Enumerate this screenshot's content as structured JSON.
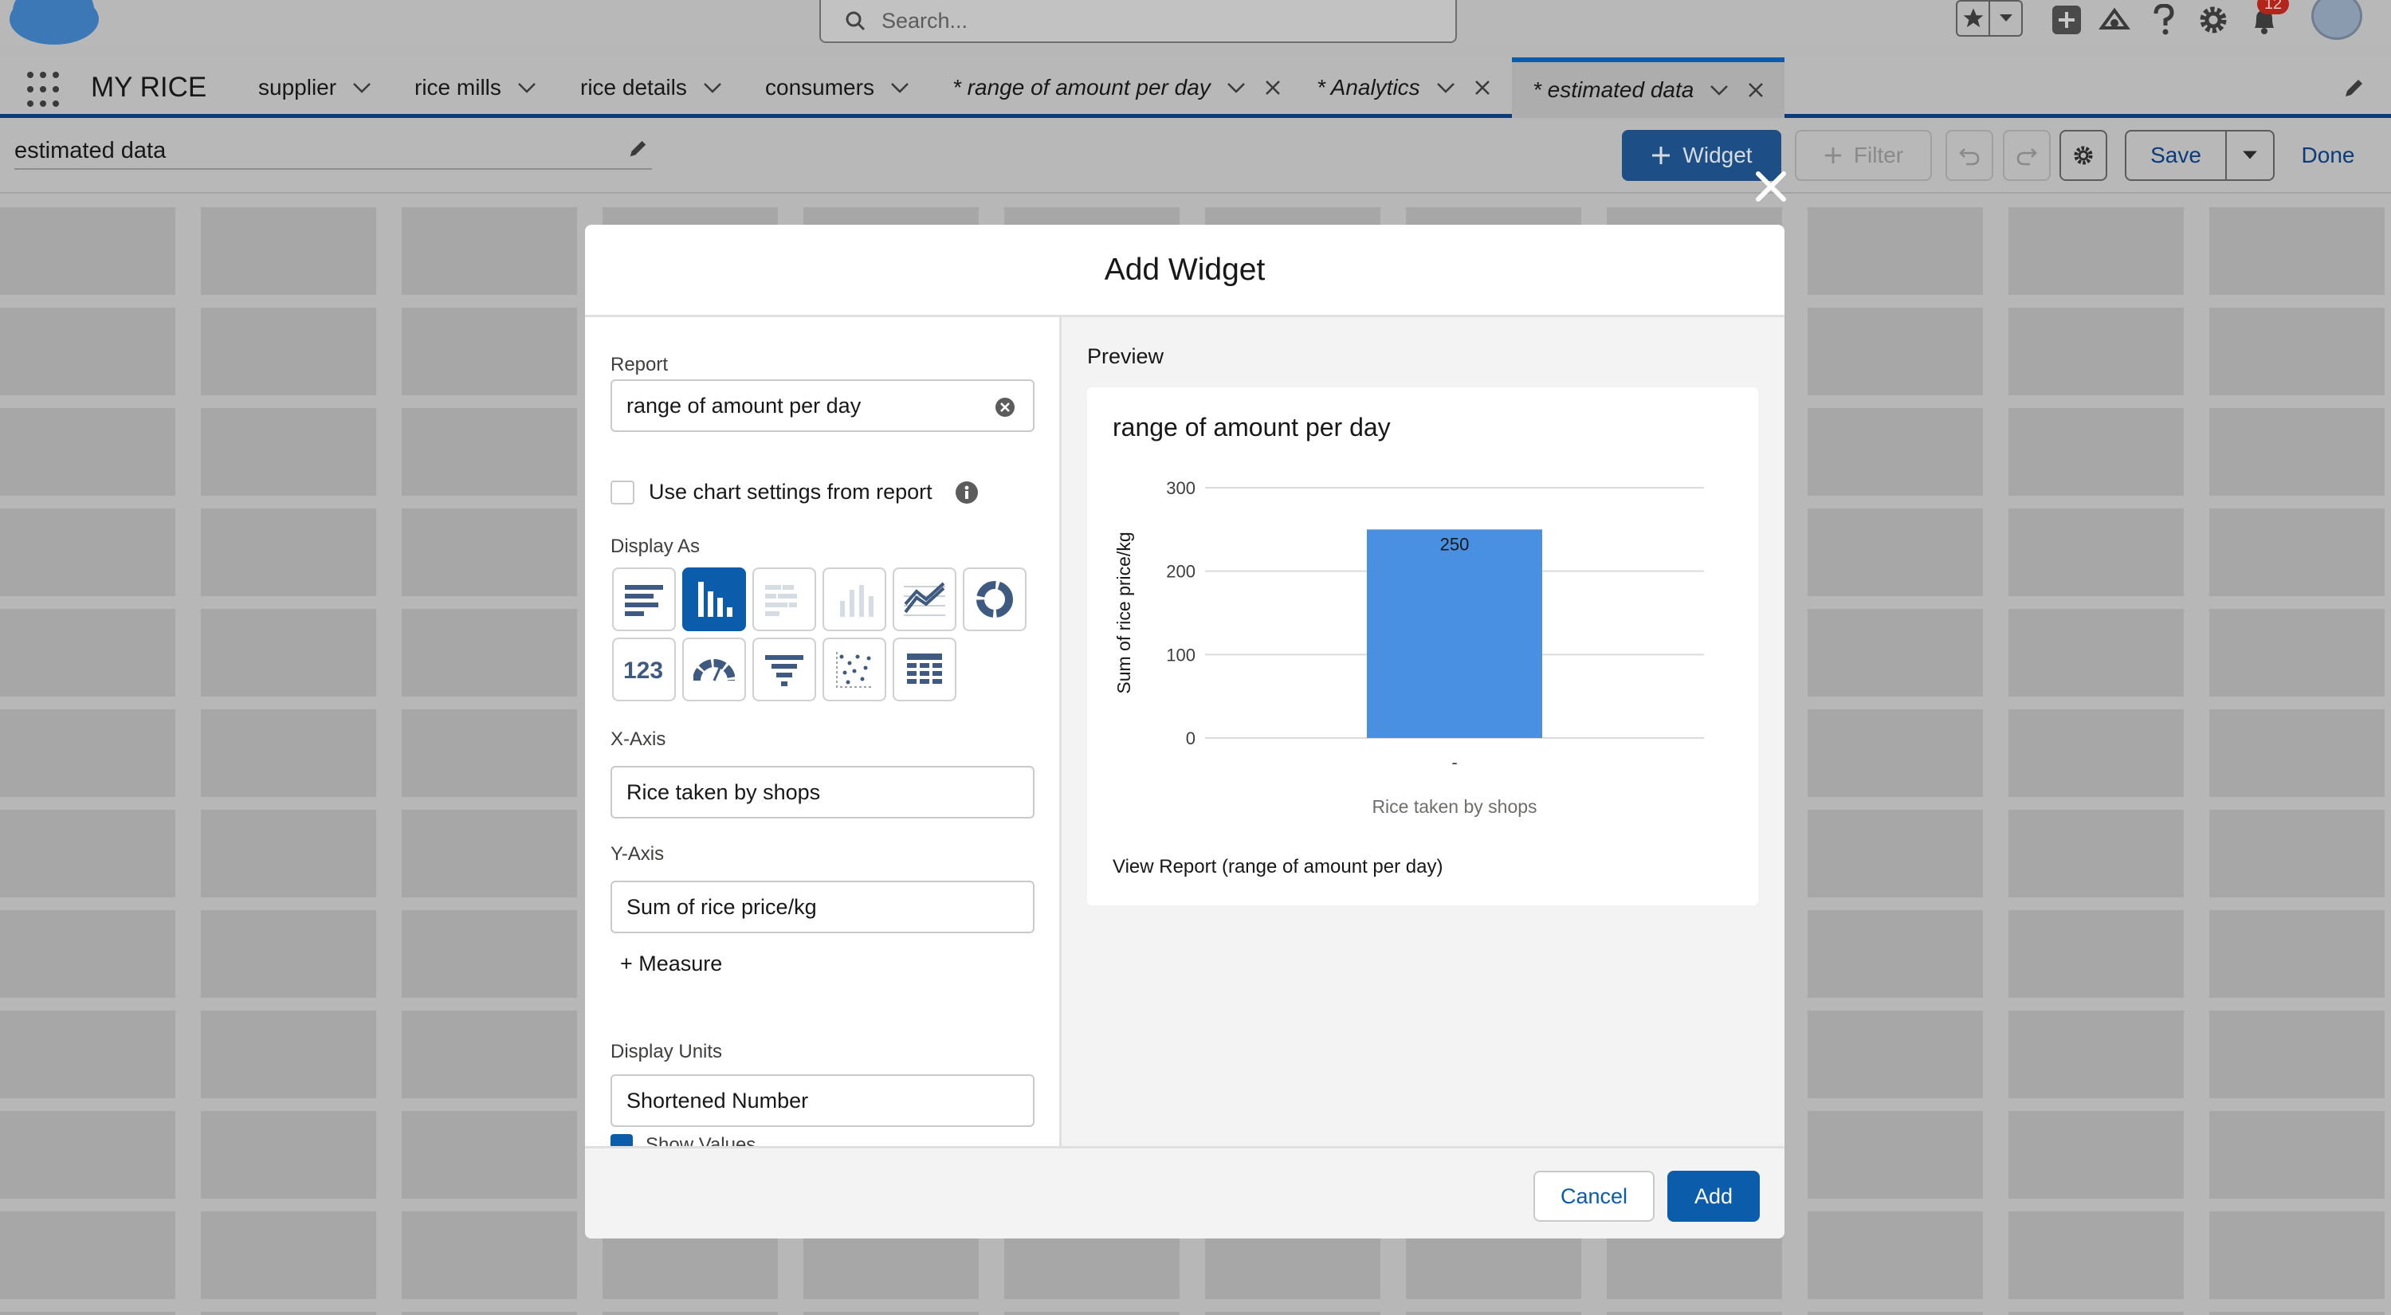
{
  "header": {
    "search_placeholder": "Search...",
    "notification_count": "12"
  },
  "nav": {
    "app_name": "MY RICE",
    "tabs": [
      {
        "label": "supplier",
        "closable": false,
        "italic": false
      },
      {
        "label": "rice mills",
        "closable": false,
        "italic": false
      },
      {
        "label": "rice details",
        "closable": false,
        "italic": false
      },
      {
        "label": "consumers",
        "closable": false,
        "italic": false
      },
      {
        "label": "* range of amount per day",
        "closable": true,
        "italic": true
      },
      {
        "label": "* Analytics",
        "closable": true,
        "italic": true
      },
      {
        "label": "* estimated data",
        "closable": true,
        "italic": true,
        "active": true
      }
    ]
  },
  "page": {
    "dashboard_title": "estimated data",
    "widget_button": "Widget",
    "filter_button": "Filter",
    "save_button": "Save",
    "done_button": "Done"
  },
  "modal": {
    "title": "Add Widget",
    "report_label": "Report",
    "report_value": "range of amount per day",
    "use_chart_settings_label": "Use chart settings from report",
    "display_as_label": "Display As",
    "x_axis_label": "X-Axis",
    "x_axis_value": "Rice taken by shops",
    "y_axis_label": "Y-Axis",
    "y_axis_value": "Sum of rice price/kg",
    "measure_link": "+ Measure",
    "display_units_label": "Display Units",
    "display_units_value": "Shortened Number",
    "show_values_label": "Show Values",
    "preview_label": "Preview",
    "preview_title": "range of amount per day",
    "view_report_link": "View Report (range of amount per day)",
    "cancel_button": "Cancel",
    "add_button": "Add"
  },
  "colors": {
    "brand_blue": "#0b5cab",
    "bar_color": "#4a90e2"
  },
  "chart_data": {
    "type": "bar",
    "categories": [
      "-"
    ],
    "values": [
      250
    ],
    "data_labels": [
      "250"
    ],
    "title": "range of amount per day",
    "xlabel": "Rice taken by shops",
    "ylabel": "Sum of rice price/kg",
    "ylim": [
      0,
      300
    ],
    "yticks": [
      0,
      100,
      200,
      300
    ],
    "grid": true
  }
}
